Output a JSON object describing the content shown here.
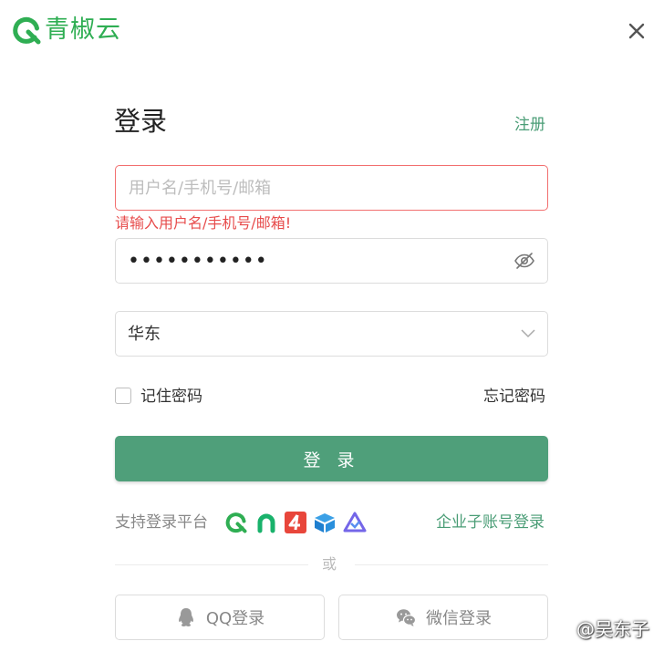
{
  "brand": {
    "name": "青椒云",
    "color": "#2fae53"
  },
  "header": {
    "close_icon": "close-icon"
  },
  "form": {
    "title": "登录",
    "register_link": "注册",
    "username": {
      "placeholder": "用户名/手机号/邮箱",
      "value": "",
      "error": "请输入用户名/手机号/邮箱!"
    },
    "password": {
      "masked_value": "•••••••••••",
      "toggle_icon": "eye-off-icon"
    },
    "region": {
      "selected": "华东",
      "icon": "chevron-down-icon"
    },
    "remember_label": "记住密码",
    "remember_checked": false,
    "forgot_link": "忘记密码",
    "login_button": "登 录",
    "accent": "#4f9f7a",
    "error_color": "#e74c4c"
  },
  "platforms": {
    "label": "支持登录平台",
    "icons": [
      "qingjiao-icon",
      "green-arc-icon",
      "four-icon",
      "box-icon",
      "triangle-logo-icon"
    ],
    "enterprise_link": "企业子账号登录"
  },
  "divider": {
    "text": "或"
  },
  "social": {
    "qq": {
      "label": "QQ登录",
      "icon": "qq-icon"
    },
    "wechat": {
      "label": "微信登录",
      "icon": "wechat-icon"
    }
  },
  "watermark": "@吴东子"
}
